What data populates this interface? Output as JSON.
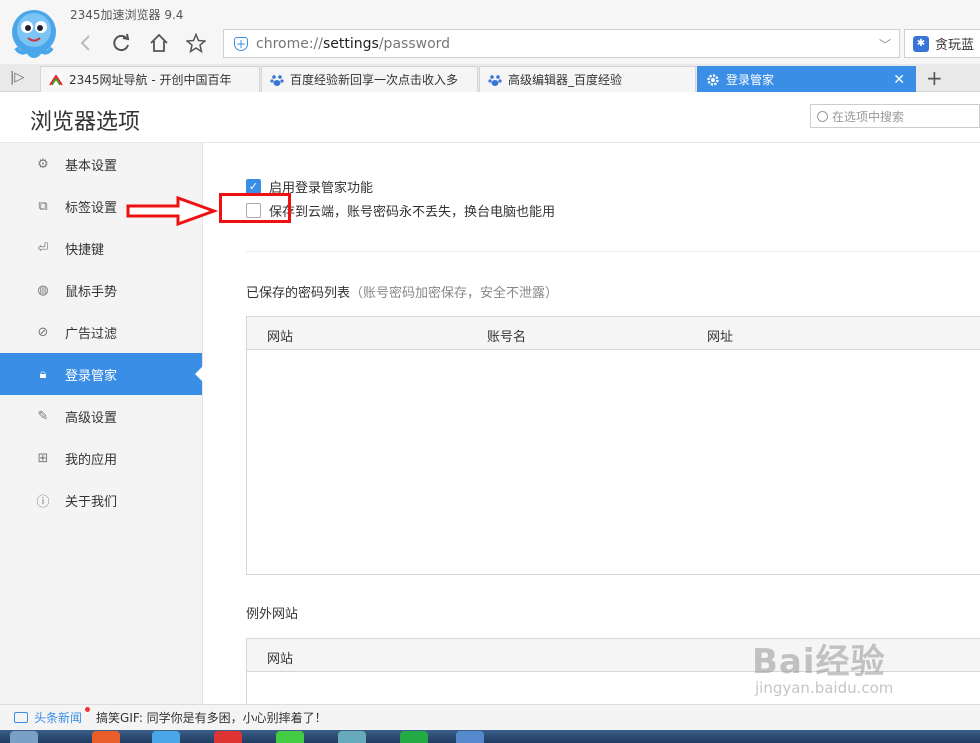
{
  "window": {
    "app_title": "2345加速浏览器 9.4",
    "address_url_prefix": "chrome://",
    "address_url_bold": "settings",
    "address_url_suffix": "/password",
    "right_search_text": "贪玩蓝"
  },
  "tabs": [
    {
      "label": "2345网址导航 - 开创中国百年",
      "icon": "2345-icon"
    },
    {
      "label": "百度经验新回享一次点击收入多",
      "icon": "paw-icon"
    },
    {
      "label": "高级编辑器_百度经验",
      "icon": "paw-icon"
    },
    {
      "label": "登录管家",
      "icon": "gear-icon",
      "active": true
    }
  ],
  "page": {
    "heading": "浏览器选项",
    "search_placeholder": "在选项中搜索"
  },
  "sidebar": {
    "items": [
      {
        "label": "基本设置",
        "icon": "gear-icon"
      },
      {
        "label": "标签设置",
        "icon": "tabs-icon"
      },
      {
        "label": "快捷键",
        "icon": "shortcut-icon"
      },
      {
        "label": "鼠标手势",
        "icon": "mouse-icon"
      },
      {
        "label": "广告过滤",
        "icon": "block-icon"
      },
      {
        "label": "登录管家",
        "icon": "lock-icon",
        "active": true
      },
      {
        "label": "高级设置",
        "icon": "wrench-icon"
      },
      {
        "label": "我的应用",
        "icon": "apps-icon"
      },
      {
        "label": "关于我们",
        "icon": "info-icon"
      }
    ]
  },
  "content": {
    "enable_label": "启用登录管家功能",
    "enable_checked": true,
    "cloud_label": "保存到云端，账号密码永不丢失，换台电脑也能用",
    "cloud_checked": false,
    "saved_title": "已保存的密码列表",
    "saved_note": "（账号密码加密保存，安全不泄露）",
    "pw_columns": [
      "网站",
      "账号名",
      "网址"
    ],
    "exception_title": "例外网站",
    "exception_columns": [
      "网站"
    ]
  },
  "news": {
    "label": "头条新闻",
    "headline": "搞笑GIF: 同学你是有多困，小心别摔着了！"
  },
  "watermark": {
    "main": "Bai经验",
    "sub": "jingyan.baidu.com"
  },
  "colors": {
    "accent": "#3a8ee6",
    "annotation": "#e11111"
  }
}
